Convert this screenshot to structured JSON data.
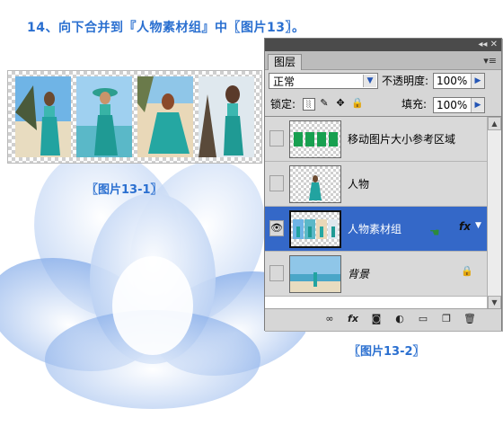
{
  "heading": "14、向下合并到『人物素材组』中〖图片13〗。",
  "captions": {
    "left": "〖图片13-1〗",
    "right": "〖图片13-2〗"
  },
  "panel": {
    "title_buttons": "◂◂ ✕",
    "tab": "图层",
    "menu_icon": "▾≡",
    "blend_mode": "正常",
    "opacity_label": "不透明度:",
    "opacity_value": "100%",
    "lock_label": "锁定:",
    "fill_label": "填充:",
    "fill_value": "100%",
    "layers": [
      {
        "name": "移动图片大小参考区域",
        "visible": false,
        "selected": false
      },
      {
        "name": "人物",
        "visible": false,
        "selected": false
      },
      {
        "name": "人物素材组",
        "visible": true,
        "selected": true,
        "fx": "fx"
      },
      {
        "name": "背景",
        "visible": false,
        "selected": false,
        "locked": true
      }
    ]
  },
  "colors": {
    "accent": "#2a6fd0",
    "selected_layer": "#3468c8"
  }
}
